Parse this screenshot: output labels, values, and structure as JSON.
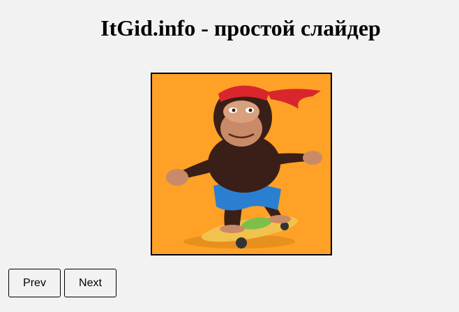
{
  "header": {
    "title": "ItGid.info - простой слайдер"
  },
  "slider": {
    "current_slide": {
      "subject": "cartoon monkey riding a skateboard",
      "background_color": "#fea126"
    }
  },
  "controls": {
    "prev_label": "Prev",
    "next_label": "Next"
  }
}
